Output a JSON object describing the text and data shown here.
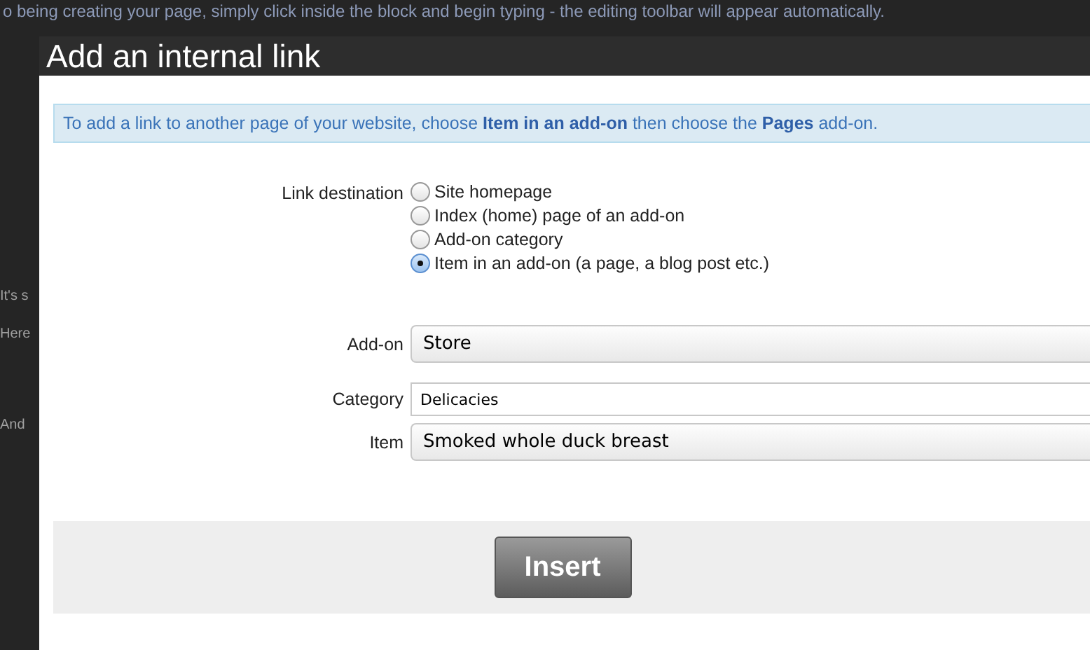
{
  "background_page": {
    "top_text": "o being creating your page, simply click inside the block and begin typing - the editing toolbar will appear automatically.",
    "side_texts": [
      "It's s",
      "Here",
      "And"
    ]
  },
  "dialog": {
    "title": "Add an internal link",
    "info": "To add a link to another page of your website, choose **Item in an add-on** then choose the **Pages** add-on.",
    "link_destination": {
      "label": "Link destination",
      "options": [
        {
          "label": "Site homepage",
          "selected": false
        },
        {
          "label": "Index (home) page of an add-on",
          "selected": false
        },
        {
          "label": "Add-on category",
          "selected": false
        },
        {
          "label": "Item in an add-on (a page, a blog post etc.)",
          "selected": true
        }
      ]
    },
    "fields": [
      {
        "kind": "select",
        "label": "Add-on",
        "value": "Store"
      },
      {
        "kind": "text",
        "label": "Category",
        "value": "Delicacies"
      },
      {
        "kind": "select",
        "label": "Item",
        "value": "Smoked whole duck breast"
      }
    ],
    "button": "Insert"
  }
}
